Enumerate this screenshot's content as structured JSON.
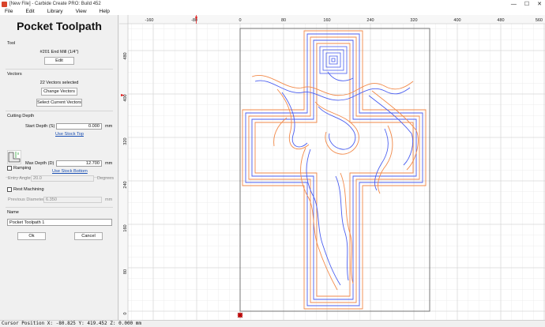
{
  "window": {
    "title": "[New File] - Carbide Create PRO: Build 452",
    "minimize": "—",
    "maximize": "☐",
    "close": "✕"
  },
  "menu": [
    "File",
    "Edit",
    "Library",
    "View",
    "Help"
  ],
  "panel": {
    "title": "Pocket Toolpath",
    "tool": {
      "section": "Tool",
      "name": "#201 End Mill (1/4\")",
      "edit_label": "Edit"
    },
    "vectors": {
      "section": "Vectors",
      "count": "22 Vectors selected",
      "change_label": "Change Vectors",
      "select_label": "Select Current Vectors"
    },
    "cutting_depth": {
      "section": "Cutting Depth",
      "start_label": "Start Depth (S)",
      "start_value": "0.000",
      "start_unit": "mm",
      "use_stock_top": "Use Stock Top",
      "max_label": "Max Depth (D)",
      "max_value": "12.700",
      "max_unit": "mm",
      "use_stock_bottom": "Use Stock Bottom"
    },
    "ramping": {
      "label": "Ramping",
      "entry_angle_label": "Entry Angle",
      "entry_angle_value": "20.0",
      "entry_angle_unit": "Degrees"
    },
    "rest": {
      "label": "Rest Machining",
      "prev_diam_label": "Previous Diameter",
      "prev_diam_value": "6.350",
      "prev_diam_unit": "mm"
    },
    "name": {
      "section": "Name",
      "value": "Pocket Toolpath 1"
    },
    "ok_label": "Ok",
    "cancel_label": "Cancel"
  },
  "canvas": {
    "ruler_top": [
      "-160",
      "-80",
      "0",
      "80",
      "160",
      "240",
      "320",
      "400",
      "480",
      "560"
    ],
    "ruler_left": [
      "480",
      "400",
      "320",
      "240",
      "160",
      "80",
      "0"
    ],
    "colors": {
      "outer_toolpath": "#f28a4a",
      "inner_toolpath": "#4a5ef0",
      "grid": "#dcdcdc",
      "origin": "#e02020"
    }
  },
  "status": "Cursor Position X: -80.825 Y: 419.452 Z: 0.000 mm"
}
